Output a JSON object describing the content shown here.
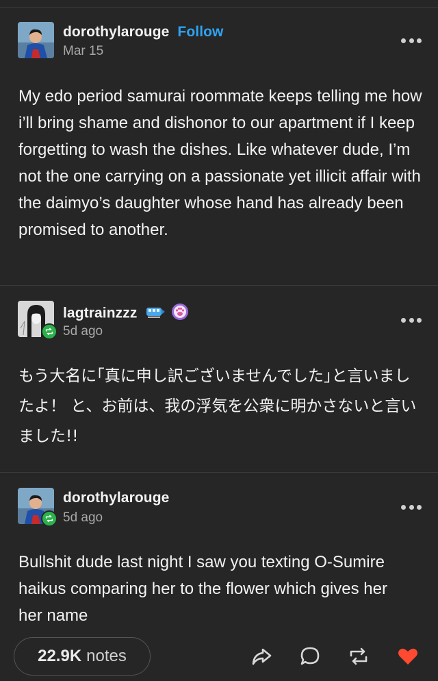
{
  "posts": [
    {
      "username": "dorothylarouge",
      "follow_label": "Follow",
      "date": "Mar 15",
      "body": "My edo period samurai roommate keeps telling me how i’ll bring shame and dishonor to our apartment if I keep forgetting to wash the dishes. Like whatever dude, I’m not the one carrying on a passionate yet illicit affair with the daimyo’s daughter whose hand has already been promised to another.",
      "avatar": "superman-avatar-icon"
    },
    {
      "username": "lagtrainzzz",
      "date": "5d ago",
      "body": "もう大名に｢真に申し訳ございませんでした｣と言いましたよ！ と、お前は、我の浮気を公衆に明かさないと言いました!!",
      "avatar": "anime-girl-avatar-icon",
      "badges": [
        "train-badge-icon",
        "paw-badge-icon"
      ]
    },
    {
      "username": "dorothylarouge",
      "date": "5d ago",
      "body": "Bullshit dude last night I saw you texting O-Sumire haikus comparing her to the flower which gives her her name",
      "avatar": "superman-avatar-icon"
    }
  ],
  "footer": {
    "notes_count": "22.9K",
    "notes_label": "notes",
    "actions": [
      "share-icon",
      "reply-icon",
      "reblog-icon",
      "like-icon"
    ]
  },
  "colors": {
    "background": "#262626",
    "follow": "#2ea3f2",
    "reblog_badge": "#2cb24a",
    "like": "#ff4930"
  }
}
